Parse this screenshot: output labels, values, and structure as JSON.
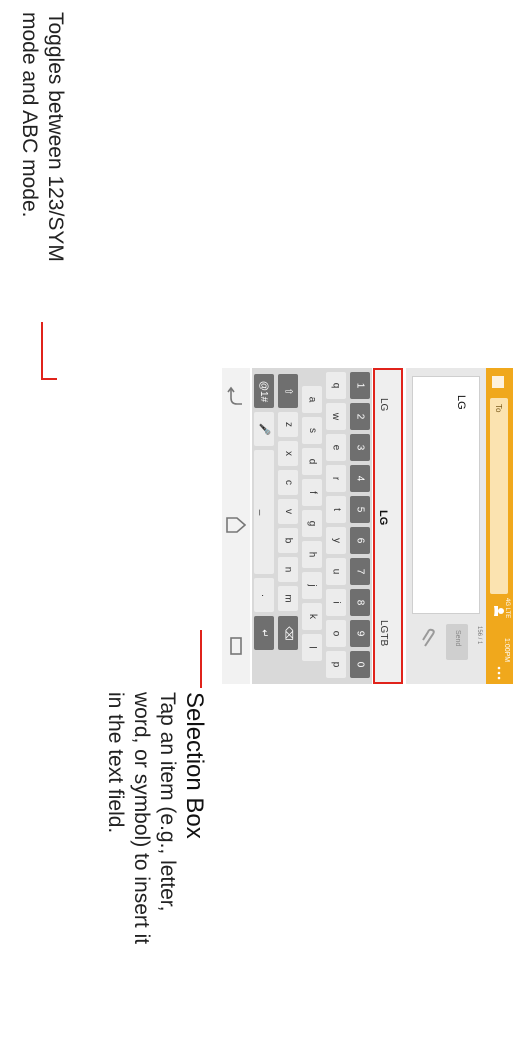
{
  "callouts": {
    "toggle": {
      "line1": "Toggles between 123/SYM",
      "line2": "mode and ABC mode."
    },
    "selection": {
      "title": "Selection Box",
      "lines": [
        "Tap an item (e.g., letter,",
        "word, or symbol) to insert it",
        "in the text field."
      ]
    }
  },
  "status_bar": {
    "time": "1:00PM",
    "network": "4G LTE"
  },
  "header": {
    "to_label": "To"
  },
  "compose": {
    "typed_text": "LG",
    "counter": "156 / 1",
    "send_label": "Send"
  },
  "suggestions": [
    "LG",
    "LG",
    "LGTB"
  ],
  "keyboard": {
    "numbers": [
      "1",
      "2",
      "3",
      "4",
      "5",
      "6",
      "7",
      "8",
      "9",
      "0"
    ],
    "row1": [
      "q",
      "w",
      "e",
      "r",
      "t",
      "y",
      "u",
      "i",
      "o",
      "p"
    ],
    "row2": [
      "a",
      "s",
      "d",
      "f",
      "g",
      "h",
      "j",
      "k",
      "l"
    ],
    "row3": [
      "z",
      "x",
      "c",
      "v",
      "b",
      "n",
      "m"
    ],
    "mode_key": "@1#",
    "space": "_"
  },
  "colors": {
    "accent": "#f0a81c",
    "callout_line": "#e0231b"
  }
}
